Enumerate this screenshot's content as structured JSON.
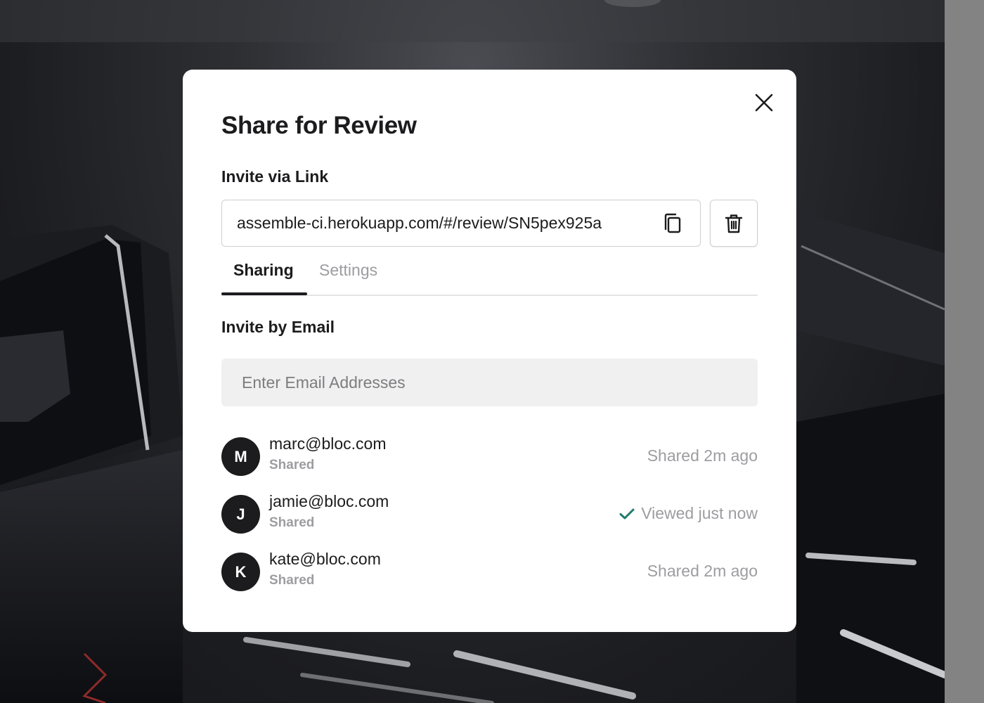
{
  "modal": {
    "title": "Share for Review",
    "invite_link_label": "Invite via Link",
    "link_value": "assemble-ci.herokuapp.com/#/review/SN5pex925a",
    "tabs": [
      {
        "label": "Sharing",
        "active": true
      },
      {
        "label": "Settings",
        "active": false
      }
    ],
    "invite_email_label": "Invite by Email",
    "email_placeholder": "Enter Email Addresses",
    "people": [
      {
        "initial": "M",
        "email": "marc@bloc.com",
        "sub": "Shared",
        "status": "Shared 2m ago",
        "viewed": false
      },
      {
        "initial": "J",
        "email": "jamie@bloc.com",
        "sub": "Shared",
        "status": "Viewed just now",
        "viewed": true
      },
      {
        "initial": "K",
        "email": "kate@bloc.com",
        "sub": "Shared",
        "status": "Shared 2m ago",
        "viewed": false
      }
    ]
  },
  "icons": {
    "close": "close-icon",
    "copy": "copy-icon",
    "delete": "trash-icon",
    "viewed": "check-icon"
  },
  "colors": {
    "text_primary": "#1c1c1e",
    "text_muted": "#9d9da1",
    "check_green": "#1f7a6d",
    "input_bg": "#f0f0f0"
  }
}
